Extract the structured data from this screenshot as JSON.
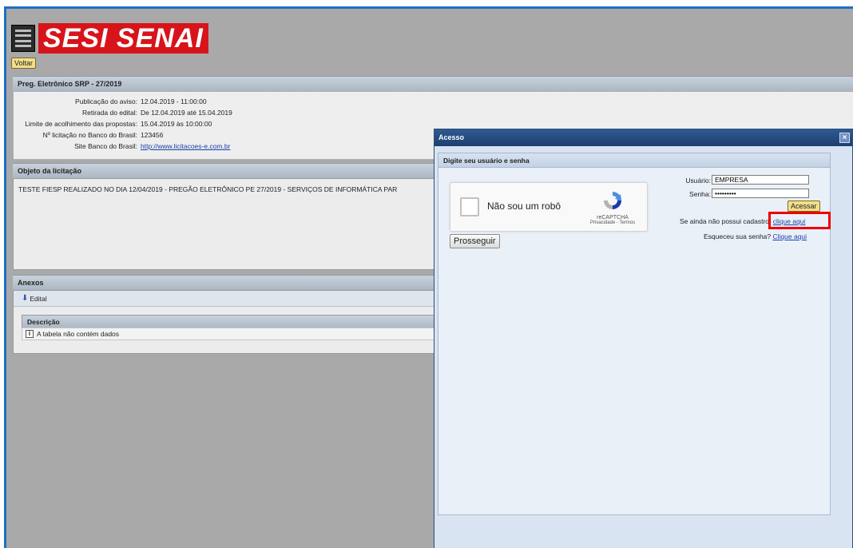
{
  "logo": {
    "text": "SESI SENAI"
  },
  "buttons": {
    "back": "Voltar"
  },
  "header": {
    "title": "Preg. Eletrônico SRP - 27/2019"
  },
  "info": [
    {
      "label": "Publicação do aviso:",
      "value": "12.04.2019 - 11:00:00"
    },
    {
      "label": "Retirada do edital:",
      "value": "De 12.04.2019 até 15.04.2019"
    },
    {
      "label": "Limite de acolhimento das propostas:",
      "value": "15.04.2019 às 10:00:00"
    },
    {
      "label": "Nº licitação no Banco do Brasil:",
      "value": "123456"
    },
    {
      "label": "Site Banco do Brasil:",
      "value": "http://www.licitacoes-e.com.br"
    }
  ],
  "objeto": {
    "title": "Objeto da licitação",
    "text": "TESTE FIESP REALIZADO NO DIA 12/04/2019 - PREGÃO ELETRÔNICO PE 27/2019 - SERVIÇOS DE INFORMÁTICA PAR"
  },
  "anexos": {
    "title": "Anexos",
    "edital": "Edital",
    "column": "Descrição",
    "empty": "A tabela não contém dados"
  },
  "dialog": {
    "title": "Acesso",
    "subtitle": "Digite seu usuário e senha",
    "recaptcha_label": "Não sou um robô",
    "recaptcha_brand": "reCAPTCHA",
    "recaptcha_links": "Privacidade - Termos",
    "prosseguir": "Prosseguir",
    "usuario_label": "Usuário:",
    "usuario_value": "EMPRESA",
    "senha_label": "Senha:",
    "senha_value": "•••••••••",
    "acessar": "Acessar",
    "cadastro_text": "Se ainda não possui cadastro,",
    "cadastro_link": "clique aqui",
    "esqueceu_text": "Esqueceu sua senha?",
    "esqueceu_link": "Clique aqui"
  },
  "colors": {
    "accent": "#1e6fc6",
    "logo_red": "#d7141a",
    "highlight": "#ee0000"
  }
}
